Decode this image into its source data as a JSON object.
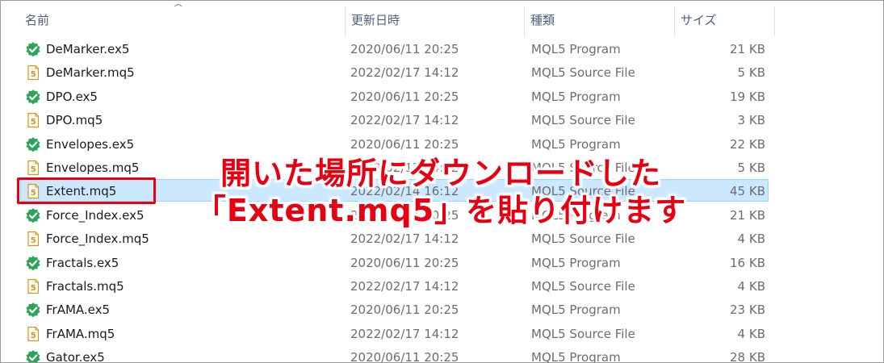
{
  "columns": {
    "name": "名前",
    "date": "更新日時",
    "type": "種類",
    "size": "サイズ"
  },
  "sort_icon": "chevron-up-icon",
  "files": [
    {
      "name": "DeMarker.ex5",
      "date": "2020/06/11 20:25",
      "type": "MQL5 Program",
      "size": "21 KB",
      "icon": "executable-check-icon"
    },
    {
      "name": "DeMarker.mq5",
      "date": "2022/02/17 14:12",
      "type": "MQL5 Source File",
      "size": "5 KB",
      "icon": "mq5-source-icon"
    },
    {
      "name": "DPO.ex5",
      "date": "2020/06/11 20:25",
      "type": "MQL5 Program",
      "size": "19 KB",
      "icon": "executable-check-icon"
    },
    {
      "name": "DPO.mq5",
      "date": "2022/02/17 14:12",
      "type": "MQL5 Source File",
      "size": "3 KB",
      "icon": "mq5-source-icon"
    },
    {
      "name": "Envelopes.ex5",
      "date": "2020/06/11 20:25",
      "type": "MQL5 Program",
      "size": "22 KB",
      "icon": "executable-check-icon"
    },
    {
      "name": "Envelopes.mq5",
      "date": "2022/02/17 14:12",
      "type": "MQL5 Source File",
      "size": "5 KB",
      "icon": "mq5-source-icon"
    },
    {
      "name": "Extent.mq5",
      "date": "2022/02/14 16:12",
      "type": "MQL5 Source File",
      "size": "45 KB",
      "icon": "mq5-source-icon",
      "selected": true
    },
    {
      "name": "Force_Index.ex5",
      "date": "2020/06/11 20:25",
      "type": "MQL5 Program",
      "size": "21 KB",
      "icon": "executable-check-icon"
    },
    {
      "name": "Force_Index.mq5",
      "date": "2022/02/17 14:12",
      "type": "MQL5 Source File",
      "size": "4 KB",
      "icon": "mq5-source-icon"
    },
    {
      "name": "Fractals.ex5",
      "date": "2020/06/11 20:25",
      "type": "MQL5 Program",
      "size": "16 KB",
      "icon": "executable-check-icon"
    },
    {
      "name": "Fractals.mq5",
      "date": "2022/02/17 14:12",
      "type": "MQL5 Source File",
      "size": "4 KB",
      "icon": "mq5-source-icon"
    },
    {
      "name": "FrAMA.ex5",
      "date": "2020/06/11 20:25",
      "type": "MQL5 Program",
      "size": "23 KB",
      "icon": "executable-check-icon"
    },
    {
      "name": "FrAMA.mq5",
      "date": "2022/02/17 14:12",
      "type": "MQL5 Source File",
      "size": "4 KB",
      "icon": "mq5-source-icon"
    },
    {
      "name": "Gator.ex5",
      "date": "2020/06/11 20:25",
      "type": "MQL5 Program",
      "size": "28 KB",
      "icon": "executable-check-icon"
    }
  ],
  "annotation": {
    "line1": "開いた場所にダウンロードした",
    "line2": "「Extent.mq5」を貼り付けます",
    "color": "#e60012"
  },
  "colors": {
    "selection": "#cce8ff",
    "header_text": "#4d6082",
    "check_green": "#2aa55a",
    "source_icon": "#c89a2a"
  }
}
